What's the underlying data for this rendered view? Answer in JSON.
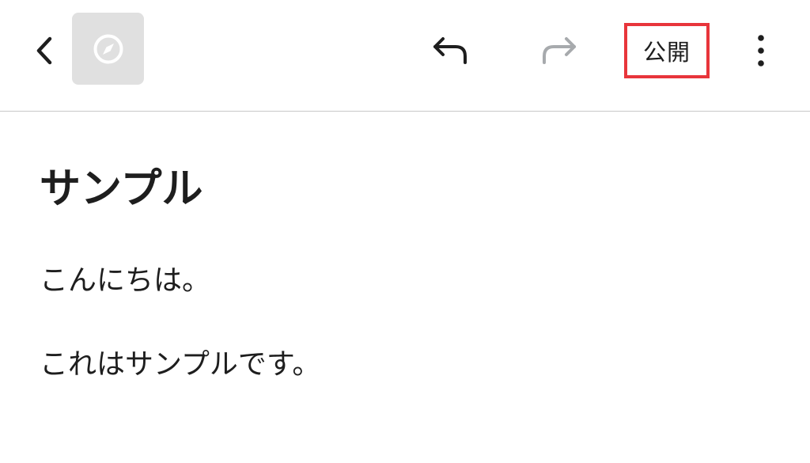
{
  "toolbar": {
    "back_icon": "chevron-left-icon",
    "site_icon": "compass-icon",
    "undo_icon": "undo-icon",
    "redo_icon": "redo-icon",
    "redo_enabled": false,
    "publish_label": "公開",
    "more_icon": "more-vertical-icon",
    "highlight_color": "#e8353b",
    "site_icon_bg": "#e0e0e0"
  },
  "post": {
    "title": "サンプル",
    "paragraphs": [
      "こんにちは。",
      "これはサンプルです。"
    ]
  }
}
